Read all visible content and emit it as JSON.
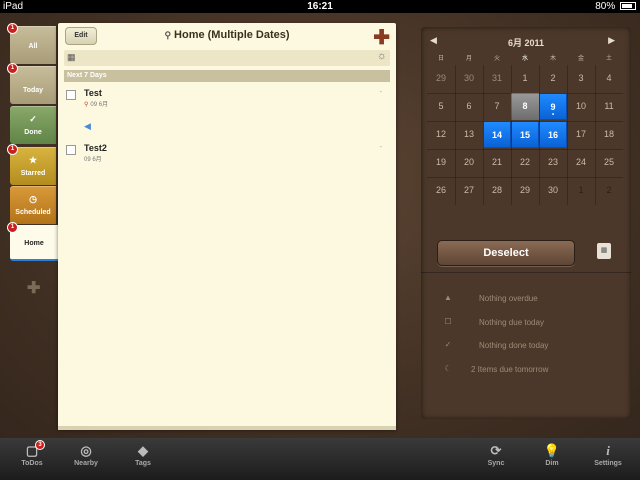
{
  "status": {
    "device": "iPad",
    "time": "16:21",
    "battery": "80%"
  },
  "tabs": [
    {
      "label": "All",
      "badge": "1"
    },
    {
      "label": "Today",
      "badge": "1"
    },
    {
      "label": "Done"
    },
    {
      "label": "Starred",
      "badge": "1"
    },
    {
      "label": "Scheduled"
    },
    {
      "label": "Home",
      "badge": "1"
    }
  ],
  "list": {
    "edit_label": "Edit",
    "title": "Home (Multiple Dates)",
    "section_label": "Next 7 Days",
    "items": [
      {
        "name": "Test",
        "due": "09 6月",
        "dash": "-"
      },
      {
        "name": "Test2",
        "due": "09 6月",
        "dash": "-"
      }
    ]
  },
  "calendar": {
    "month_label": "6月 2011",
    "weekdays": [
      "日",
      "月",
      "火",
      "水",
      "木",
      "金",
      "土"
    ],
    "weeks": [
      [
        "29",
        "30",
        "31",
        "1",
        "2",
        "3",
        "4"
      ],
      [
        "5",
        "6",
        "7",
        "8",
        "9",
        "10",
        "11"
      ],
      [
        "12",
        "13",
        "14",
        "15",
        "16",
        "17",
        "18"
      ],
      [
        "19",
        "20",
        "21",
        "22",
        "23",
        "24",
        "25"
      ],
      [
        "26",
        "27",
        "28",
        "29",
        "30",
        "1",
        "2"
      ]
    ],
    "today": "8",
    "selected": [
      "9",
      "14",
      "15",
      "16"
    ],
    "deselect_label": "Deselect",
    "summary": [
      {
        "icon": "warning-icon",
        "text": "Nothing overdue"
      },
      {
        "icon": "checkbox-icon",
        "text": "Nothing due today"
      },
      {
        "icon": "checkmark-icon",
        "text": "Nothing done today"
      },
      {
        "icon": "moon-icon",
        "text": "2 Items due tomorrow"
      }
    ]
  },
  "tabbar": {
    "todos_label": "ToDos",
    "todos_badge": "3",
    "nearby_label": "Nearby",
    "tags_label": "Tags",
    "sync_label": "Sync",
    "dim_label": "Dim",
    "settings_label": "Settings"
  }
}
